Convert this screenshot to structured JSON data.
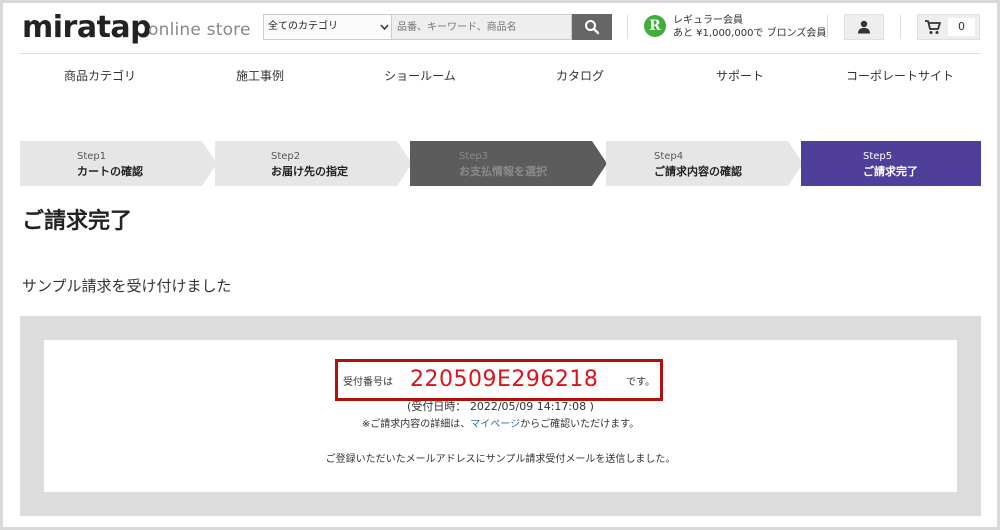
{
  "header": {
    "logo": "miratap",
    "logo_sub": "online store",
    "category_select": "全てのカテゴリ",
    "search_placeholder": "品番、キーワード、商品名",
    "member_badge": "R",
    "member_rank": "レギュラー会員",
    "member_next": "あと ¥1,000,000で ブロンズ会員",
    "cart_count": "0"
  },
  "nav": {
    "items": [
      {
        "label": "商品カテゴリ"
      },
      {
        "label": "施工事例"
      },
      {
        "label": "ショールーム"
      },
      {
        "label": "カタログ"
      },
      {
        "label": "サポート"
      },
      {
        "label": "コーポレートサイト"
      }
    ]
  },
  "steps": [
    {
      "step": "Step1",
      "label": "カートの確認",
      "state": "done"
    },
    {
      "step": "Step2",
      "label": "お届け先の指定",
      "state": "done"
    },
    {
      "step": "Step3",
      "label": "お支払情報を選択",
      "state": "skipped"
    },
    {
      "step": "Step4",
      "label": "ご請求内容の確認",
      "state": "done"
    },
    {
      "step": "Step5",
      "label": "ご請求完了",
      "state": "current"
    }
  ],
  "main": {
    "title": "ご請求完了",
    "subtitle": "サンプル請求を受け付けました",
    "receipt_label": "受付番号は",
    "receipt_number": "220509E296218",
    "receipt_suffix": "です。",
    "receipt_date": "(受付日時： 2022/05/09 14:17:08 )",
    "detail_prefix": "※ご請求内容の詳細は、",
    "detail_link": "マイページ",
    "detail_suffix": "からご確認いただけます。",
    "mail_notice": "ご登録いただいたメールアドレスにサンプル請求受付メールを送信しました。"
  },
  "colors": {
    "step_light": "#e6e6e6",
    "step_dark": "#5c5c5c",
    "step_active": "#4f3f9a",
    "receipt_number": "#d9141b",
    "highlight_border": "#b20f0f",
    "member_badge": "#3fae3a",
    "link": "#2a6ab8"
  }
}
